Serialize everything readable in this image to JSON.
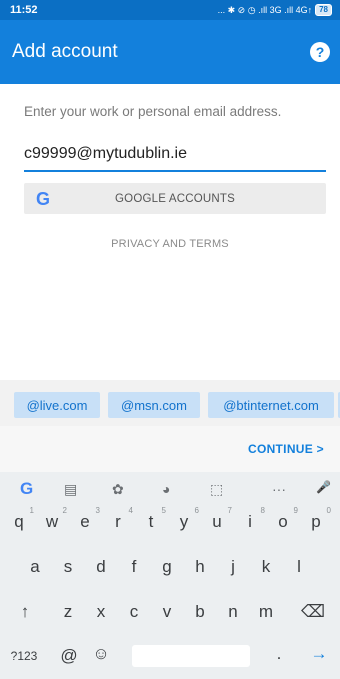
{
  "status": {
    "time": "11:52",
    "icons_text": "... ✱ ⊘ ◷ .ıll 3G .ıll 4G↑",
    "battery": "78"
  },
  "appbar": {
    "title": "Add account",
    "help_icon": "?"
  },
  "form": {
    "prompt": "Enter your work or personal email address.",
    "email_value": "c99999@mytudublin.ie",
    "google_icon": "G",
    "google_button": "GOOGLE ACCOUNTS",
    "privacy": "PRIVACY AND TERMS"
  },
  "suggestions": [
    "@live.com",
    "@msn.com",
    "@btinternet.com"
  ],
  "continue": "CONTINUE  >",
  "keyboard": {
    "toolbar": [
      "G",
      "▤",
      "✿",
      "◕",
      "⬚",
      "···",
      "🎤"
    ],
    "row1": [
      {
        "k": "q",
        "n": "1"
      },
      {
        "k": "w",
        "n": "2"
      },
      {
        "k": "e",
        "n": "3"
      },
      {
        "k": "r",
        "n": "4"
      },
      {
        "k": "t",
        "n": "5"
      },
      {
        "k": "y",
        "n": "6"
      },
      {
        "k": "u",
        "n": "7"
      },
      {
        "k": "i",
        "n": "8"
      },
      {
        "k": "o",
        "n": "9"
      },
      {
        "k": "p",
        "n": "0"
      }
    ],
    "row2": [
      "a",
      "s",
      "d",
      "f",
      "g",
      "h",
      "j",
      "k",
      "l"
    ],
    "row3": [
      "↑",
      "z",
      "x",
      "c",
      "v",
      "b",
      "n",
      "m",
      "⌫"
    ],
    "row4": [
      "?123",
      "@",
      "☺",
      ".",
      "→"
    ]
  },
  "colors": {
    "primary": "#1380dc",
    "statusbar": "#0b6fc4",
    "chip_bg": "#c8e0f7"
  }
}
